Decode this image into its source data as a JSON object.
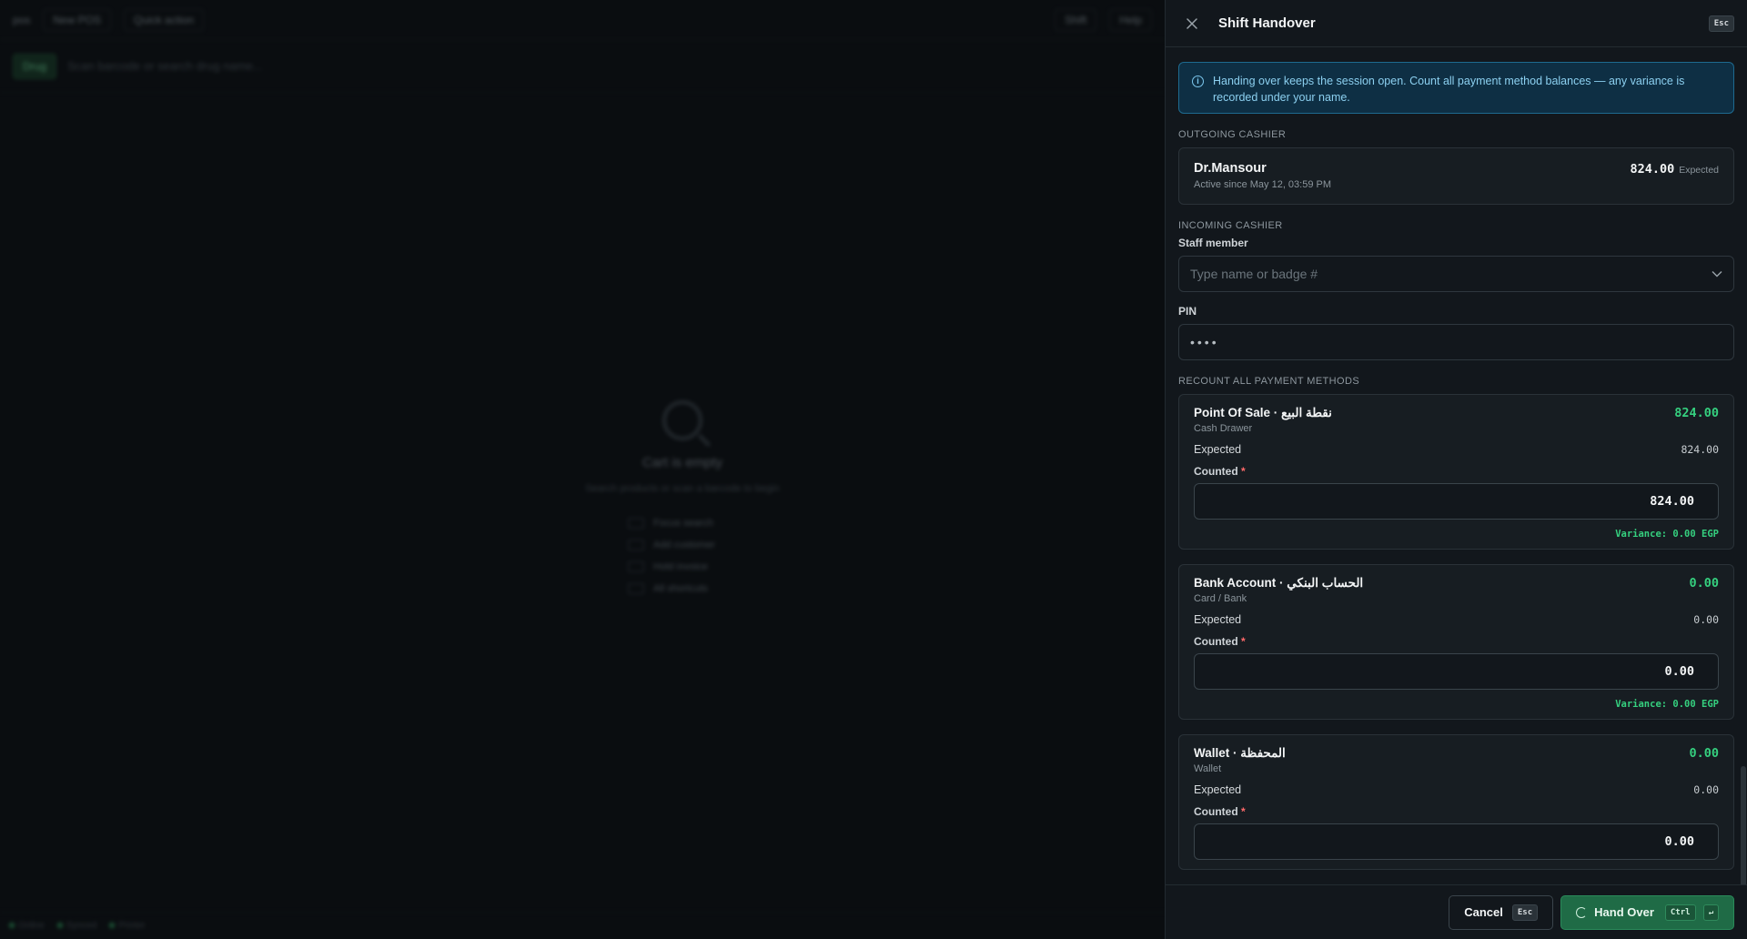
{
  "background": {
    "topbar": {
      "logo": "pos",
      "pill1": "New POS",
      "pill2": "Quick action",
      "right1": "Shift",
      "right2": "Help"
    },
    "chip": "Drug",
    "search_placeholder": "Scan barcode or search drug name...",
    "empty": {
      "title": "Cart is empty",
      "subtitle": "Search products or scan a barcode to begin",
      "shortcuts": [
        "Focus search",
        "Add customer",
        "Hold invoice",
        "All shortcuts"
      ]
    },
    "status": {
      "s1": "Online",
      "s2": "Synced",
      "s3": "Printer"
    }
  },
  "drawer": {
    "title": "Shift Handover",
    "esc_key": "Esc",
    "info": "Handing over keeps the session open. Count all payment method balances — any variance is recorded under your name.",
    "outgoing": {
      "label": "OUTGOING CASHIER",
      "name": "Dr.Mansour",
      "since": "Active since May 12, 03:59 PM",
      "amount": "824.00",
      "amount_label": "Expected"
    },
    "incoming": {
      "label": "INCOMING CASHIER",
      "staff_label": "Staff member",
      "staff_placeholder": "Type name or badge #",
      "pin_label": "PIN",
      "pin_value": "••••"
    },
    "recount_label": "RECOUNT ALL PAYMENT METHODS",
    "methods": [
      {
        "name": "Point Of Sale · نقطة البيع",
        "type": "Cash Drawer",
        "amount": "824.00",
        "expected_label": "Expected",
        "expected": "824.00",
        "counted_label": "Counted",
        "counted": "824.00",
        "variance": "Variance: 0.00 EGP"
      },
      {
        "name": "Bank Account · الحساب البنكي",
        "type": "Card / Bank",
        "amount": "0.00",
        "expected_label": "Expected",
        "expected": "0.00",
        "counted_label": "Counted",
        "counted": "0.00",
        "variance": "Variance: 0.00 EGP"
      },
      {
        "name": "Wallet · المحفظة",
        "type": "Wallet",
        "amount": "0.00",
        "expected_label": "Expected",
        "expected": "0.00",
        "counted_label": "Counted",
        "counted": "0.00",
        "variance": ""
      }
    ],
    "footer": {
      "cancel": "Cancel",
      "cancel_key": "Esc",
      "submit": "Hand Over",
      "submit_key1": "Ctrl",
      "submit_key2": "↵"
    }
  },
  "colors": {
    "accent_green": "#35d07f",
    "info_blue": "#1e6a8f",
    "primary_button": "#1f6b46"
  }
}
